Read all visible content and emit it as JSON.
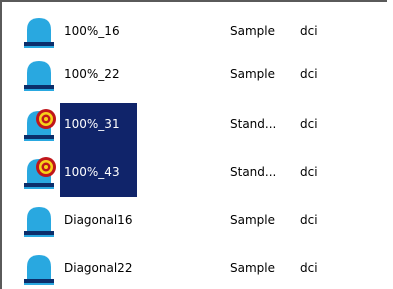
{
  "colors": {
    "selection": "#10246a",
    "icon_blue": "#29a8e0",
    "icon_bar": "#0b2e6b",
    "badge_red": "#c0161b",
    "badge_yellow": "#f6d21a"
  },
  "rows": [
    {
      "name": "100%_16",
      "type": "Sample",
      "ext": "dci",
      "icon": "sample-icon",
      "badge": false,
      "selected": false
    },
    {
      "name": "100%_22",
      "type": "Sample",
      "ext": "dci",
      "icon": "sample-icon",
      "badge": false,
      "selected": false
    },
    {
      "name": "100%_31",
      "type": "Stand...",
      "ext": "dci",
      "icon": "standard-icon",
      "badge": true,
      "selected": true
    },
    {
      "name": "100%_43",
      "type": "Stand...",
      "ext": "dci",
      "icon": "standard-icon",
      "badge": true,
      "selected": true
    },
    {
      "name": "Diagonal16",
      "type": "Sample",
      "ext": "dci",
      "icon": "sample-icon",
      "badge": false,
      "selected": false
    },
    {
      "name": "Diagonal22",
      "type": "Sample",
      "ext": "dci",
      "icon": "sample-icon",
      "badge": false,
      "selected": false
    }
  ]
}
